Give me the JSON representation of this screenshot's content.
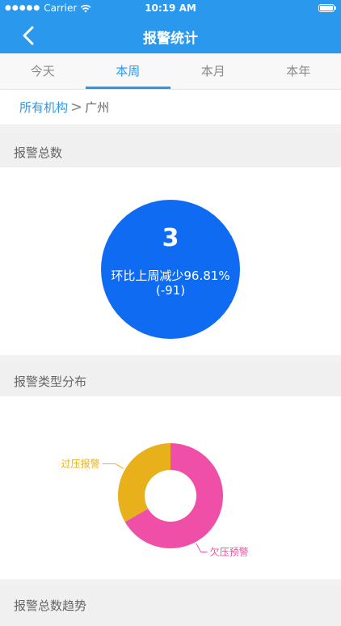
{
  "status_bar": {
    "carrier": "Carrier",
    "time": "10:19 AM"
  },
  "nav": {
    "title": "报警统计"
  },
  "tabs": [
    {
      "label": "今天",
      "active": false
    },
    {
      "label": "本周",
      "active": true
    },
    {
      "label": "本月",
      "active": false
    },
    {
      "label": "本年",
      "active": false
    }
  ],
  "breadcrumb": {
    "root": "所有机构",
    "separator": ">",
    "current": "广州"
  },
  "sections": {
    "total": "报警总数",
    "types": "报警类型分布",
    "trend": "报警总数趋势"
  },
  "total": {
    "count": "3",
    "compare": "环比上周减少96.81%",
    "delta": "(-91)"
  },
  "colors": {
    "primary": "#2a98ed",
    "circle": "#0f6cf2",
    "overdue": "#ef4fa6",
    "overpressure": "#e8b11c"
  },
  "chart_data": {
    "type": "pie",
    "labels": [
      "过压报警",
      "欠压预警"
    ],
    "values": [
      33.3,
      66.7
    ],
    "colors": [
      "#e8b11c",
      "#ef4fa6"
    ],
    "donut": true
  }
}
